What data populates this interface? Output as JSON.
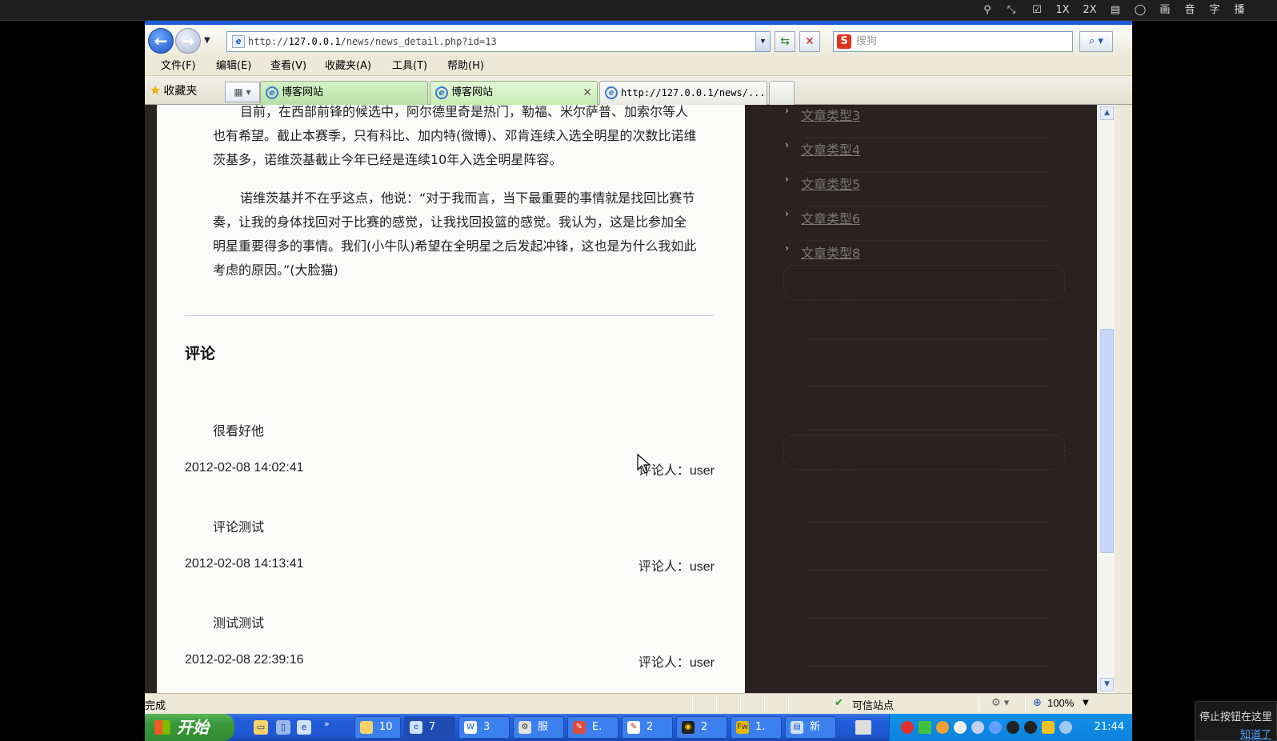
{
  "player": {
    "controls": [
      "1X",
      "2X",
      "画",
      "音",
      "字",
      "播"
    ]
  },
  "browser": {
    "address": {
      "scheme": "http://",
      "host": "127.0.0.1",
      "path": "/news/news_detail.php?id=13"
    },
    "search_placeholder": "搜狗",
    "search_logo": "S",
    "menu": [
      "文件(F)",
      "编辑(E)",
      "查看(V)",
      "收藏夹(A)",
      "工具(T)",
      "帮助(H)"
    ],
    "favorites_label": "收藏夹",
    "tabs": [
      {
        "label": "博客网站"
      },
      {
        "label": "博客网站"
      },
      {
        "label": "http://127.0.0.1/news/..."
      }
    ]
  },
  "article": {
    "para1": "目前，在西部前锋的候选中，阿尔德里奇是热门，勒福、米尔萨普、加索尔等人也有希望。截止本赛季，只有科比、加内特(微博)、邓肯连续入选全明星的次数比诺维茨基多，诺维茨基截止今年已经是连续10年入选全明星阵容。",
    "para2": "诺维茨基并不在乎这点，他说：“对于我而言，当下最重要的事情就是找回比赛节奏，让我的身体找回对于比赛的感觉，让我找回投篮的感觉。我认为，这是比参加全明星重要得多的事情。我们(小牛队)希望在全明星之后发起冲锋，这也是为什么我如此考虑的原因。”(大脸猫)"
  },
  "comments": {
    "heading": "评论",
    "author_prefix": "评论人：",
    "items": [
      {
        "text": "很看好他",
        "time": "2012-02-08 14:02:41",
        "author": "user"
      },
      {
        "text": "评论测试",
        "time": "2012-02-08 14:13:41",
        "author": "user"
      },
      {
        "text": "测试测试",
        "time": "2012-02-08 22:39:16",
        "author": "user"
      }
    ]
  },
  "sidebar": {
    "categories": [
      "文章类型3",
      "文章类型4",
      "文章类型5",
      "文章类型6",
      "文章类型8"
    ]
  },
  "status": {
    "left": "完成",
    "zone": "可信站点",
    "zoom": "100%"
  },
  "taskbar": {
    "start_label": "开始",
    "buttons": [
      "10",
      "7",
      "3",
      "服",
      "E.",
      "2",
      "2",
      "1.",
      "新"
    ],
    "clock": "21:44"
  },
  "notification": {
    "line1": "停止按钮在这里",
    "link": "知道了"
  }
}
